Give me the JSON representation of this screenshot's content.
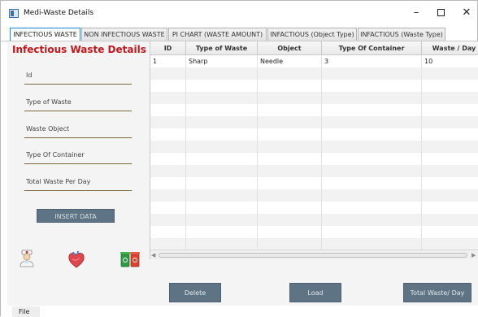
{
  "window": {
    "title": "Medi-Waste Details",
    "minimize_glyph": "–",
    "close_glyph": "✕"
  },
  "tabs": [
    {
      "label": "INFECTIOUS WASTE",
      "active": true
    },
    {
      "label": "NON INFECTIOUS WASTE",
      "active": false
    },
    {
      "label": "PI CHART (WASTE AMOUNT)",
      "active": false
    },
    {
      "label": "INFACTIOUS (Object Type)",
      "active": false
    },
    {
      "label": "INFACTIOUS (Waste Type)",
      "active": false
    }
  ],
  "form": {
    "title": "Infectious Waste Details",
    "fields": [
      {
        "label": "Id"
      },
      {
        "label": "Type of Waste"
      },
      {
        "label": "Waste Object"
      },
      {
        "label": "Type Of Container"
      },
      {
        "label": "Total Waste Per Day"
      }
    ],
    "insert_label": "INSERT DATA"
  },
  "icons": {
    "doctor": "doctor-icon",
    "heart": "heart-organ-icon",
    "bins": "recycle-bins-icon",
    "colors": {
      "heart": "#e0474c",
      "bin_green": "#2e9a43",
      "bin_red": "#d9422f"
    }
  },
  "table": {
    "columns": [
      "ID",
      "Type of Waste",
      "Object",
      "Type Of Container",
      "Waste / Day"
    ],
    "rows": [
      [
        "1",
        "Sharp",
        "Needle",
        "3",
        "10"
      ]
    ]
  },
  "buttons": {
    "delete": "Delete",
    "load": "Load",
    "total": "Total Waste/ Day"
  },
  "menu": {
    "file": "File"
  },
  "colors": {
    "title_red": "#c4161c",
    "button_slate": "#5e7484",
    "tab_active_border": "#1a8cd8"
  }
}
